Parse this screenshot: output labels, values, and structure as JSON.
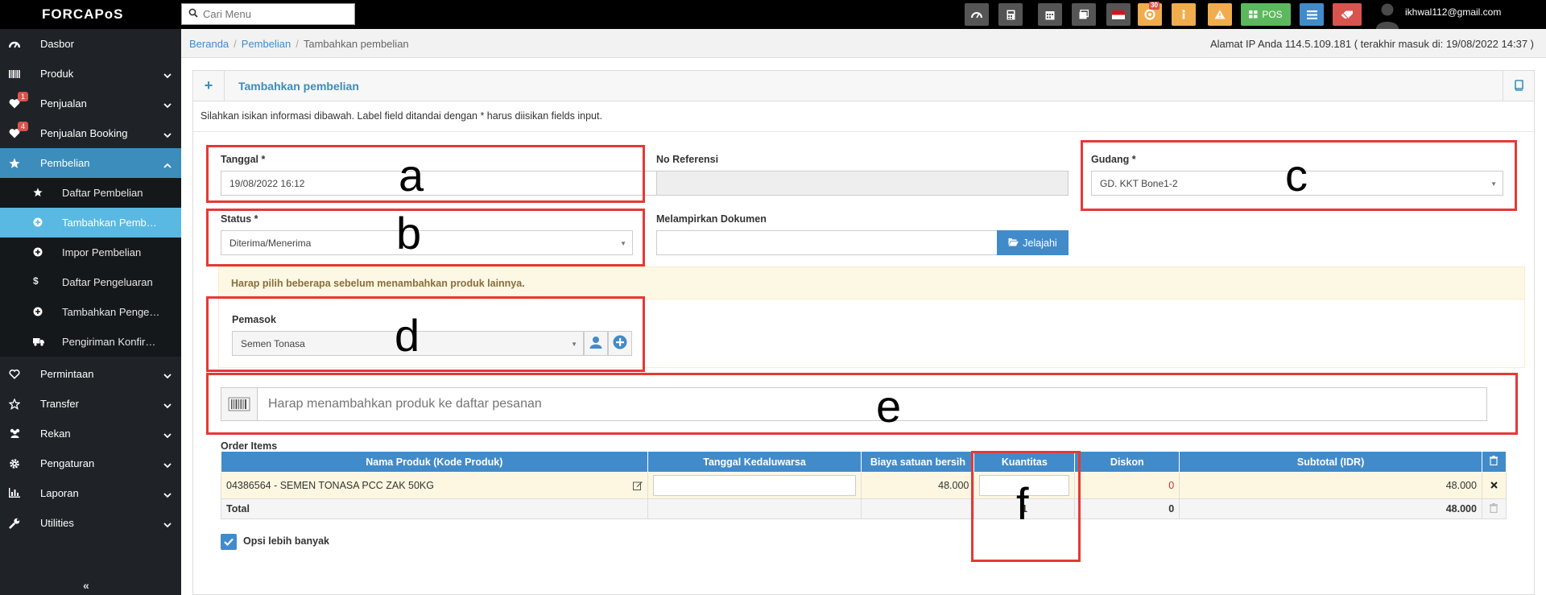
{
  "topbar": {
    "logo": "FORCAPoS",
    "search_placeholder": "Cari Menu",
    "buttons": [
      {
        "icon": "dashboard-icon",
        "color": "#555555"
      },
      {
        "icon": "calculator-icon",
        "color": "#555555"
      },
      {
        "icon": "calendar-icon",
        "color": "#555555"
      },
      {
        "icon": "display-icon",
        "color": "#555555"
      },
      {
        "icon": "flag-indonesia-icon",
        "color": "#555555"
      },
      {
        "icon": "notification-icon",
        "color": "#f0ad4e",
        "badge": "30"
      },
      {
        "icon": "info-icon",
        "color": "#f0ad4e"
      },
      {
        "icon": "warning-icon",
        "color": "#f0ad4e"
      },
      {
        "icon": "pos-icon",
        "color": "#5cb85c",
        "label": "POS"
      },
      {
        "icon": "list-icon",
        "color": "#428bca"
      },
      {
        "icon": "eraser-icon",
        "color": "#d9534f"
      }
    ],
    "user_email": "ikhwal112@gmail.com"
  },
  "sidebar": {
    "items": [
      {
        "label": "Dasbor",
        "icon": "dashboard-icon"
      },
      {
        "label": "Produk",
        "icon": "barcode-icon",
        "chevron": "down"
      },
      {
        "label": "Penjualan",
        "icon": "heart-icon",
        "badge": "1",
        "chevron": "down"
      },
      {
        "label": "Penjualan Booking",
        "icon": "heart-icon",
        "badge": "4",
        "chevron": "down"
      },
      {
        "label": "Pembelian",
        "icon": "star-icon",
        "chevron": "up",
        "active": true
      },
      {
        "label": "Permintaan",
        "icon": "heart-outline-icon",
        "chevron": "down"
      },
      {
        "label": "Transfer",
        "icon": "star-outline-icon",
        "chevron": "down"
      },
      {
        "label": "Rekan",
        "icon": "users-icon",
        "chevron": "down"
      },
      {
        "label": "Pengaturan",
        "icon": "cog-icon",
        "chevron": "down"
      },
      {
        "label": "Laporan",
        "icon": "bar-chart-icon",
        "chevron": "down"
      },
      {
        "label": "Utilities",
        "icon": "wrench-icon",
        "chevron": "down"
      }
    ],
    "subitems": [
      {
        "label": "Daftar Pembelian",
        "icon": "star-icon"
      },
      {
        "label": "Tambahkan Pembelian",
        "icon": "plus-circle-icon",
        "active": true
      },
      {
        "label": "Impor Pembelian",
        "icon": "plus-circle-icon"
      },
      {
        "label": "Daftar Pengeluaran",
        "icon": "dollar-icon"
      },
      {
        "label": "Tambahkan Pengeluaran",
        "icon": "plus-circle-icon"
      },
      {
        "label": "Pengiriman Konfirmasi",
        "icon": "truck-icon"
      }
    ],
    "collapse_label": "«"
  },
  "breadcrumb": {
    "items": [
      "Beranda",
      "Pembelian",
      "Tambahkan pembelian"
    ],
    "ip_info": "Alamat IP Anda 114.5.109.181 ( terakhir masuk di: 19/08/2022 14:37 )"
  },
  "form": {
    "title": "Tambahkan pembelian",
    "intro": "Silahkan isikan informasi dibawah. Label field ditandai dengan * harus diisikan fields input.",
    "tanggal_label": "Tanggal *",
    "tanggal_value": "19/08/2022 16:12",
    "noref_label": "No Referensi",
    "noref_value": "",
    "gudang_label": "Gudang *",
    "gudang_value": "GD. KKT Bone1-2",
    "status_label": "Status *",
    "status_value": "Diterima/Menerima",
    "lampiran_label": "Melampirkan Dokumen",
    "lampiran_button": "Jelajahi",
    "warning": "Harap pilih beberapa sebelum menambahkan produk lainnya.",
    "pemasok_label": "Pemasok",
    "pemasok_value": "Semen Tonasa",
    "scan_placeholder": "Harap menambahkan produk ke daftar pesanan",
    "order_items_label": "Order Items",
    "more_options_label": "Opsi lebih banyak"
  },
  "table": {
    "headers": [
      "Nama Produk (Kode Produk)",
      "Tanggal Kedaluwarsa",
      "Biaya satuan bersih",
      "Kuantitas",
      "Diskon",
      "Subtotal (IDR)"
    ],
    "rows": [
      {
        "product": "04386564 - SEMEN TONASA PCC ZAK 50KG",
        "expiry": "",
        "unit_cost": "48.000",
        "quantity": "",
        "discount": "0",
        "subtotal": "48.000"
      }
    ],
    "footer": {
      "label": "Total",
      "quantity": "1",
      "discount": "0",
      "subtotal": "48.000"
    }
  },
  "annotations": [
    "a",
    "b",
    "c",
    "d",
    "e",
    "f"
  ],
  "colors": {
    "accent": "#428bca",
    "sidebar_bg": "#1f2327",
    "sidebar_active": "#3c8dbc",
    "annotation_red": "#e53935"
  }
}
